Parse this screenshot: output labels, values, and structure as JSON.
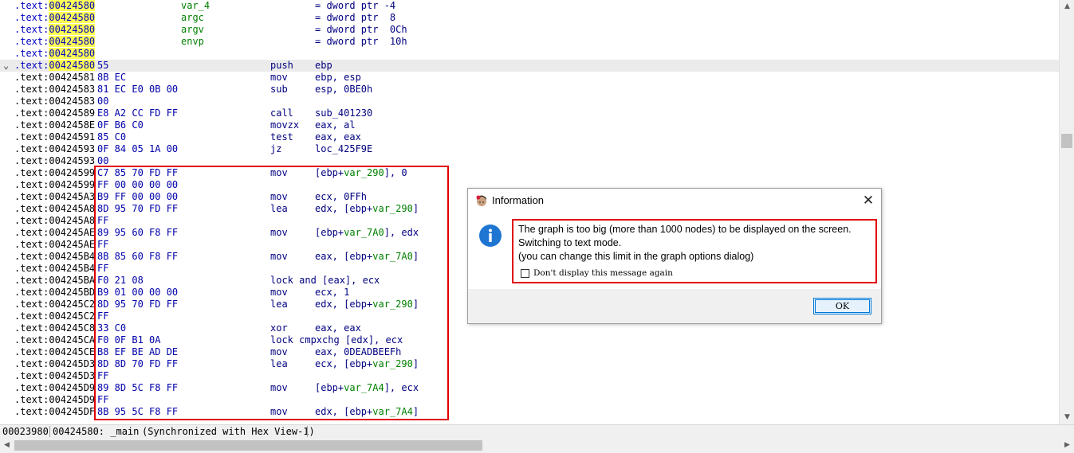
{
  "listing": {
    "rows": [
      {
        "seg": ".text:",
        "addr": "00424580",
        "hl": true,
        "bytes": "",
        "name": "var_4",
        "mnem": "",
        "ops": "= dword ptr -4"
      },
      {
        "seg": ".text:",
        "addr": "00424580",
        "hl": true,
        "bytes": "",
        "name": "argc",
        "mnem": "",
        "ops": "= dword ptr  8"
      },
      {
        "seg": ".text:",
        "addr": "00424580",
        "hl": true,
        "bytes": "",
        "name": "argv",
        "mnem": "",
        "ops": "= dword ptr  0Ch"
      },
      {
        "seg": ".text:",
        "addr": "00424580",
        "hl": true,
        "bytes": "",
        "name": "envp",
        "mnem": "",
        "ops": "= dword ptr  10h"
      },
      {
        "seg": ".text:",
        "addr": "00424580",
        "hl": true,
        "bytes": "",
        "name": "",
        "mnem": "",
        "ops": ""
      },
      {
        "seg": ".text:",
        "addr": "00424580",
        "hl": true,
        "bytes": "55",
        "name": "",
        "mnem": "push",
        "ops": "ebp",
        "current": true,
        "fold": "⌄"
      },
      {
        "seg": ".text:",
        "addr": "00424581",
        "bytes": "8B EC",
        "name": "",
        "mnem": "mov",
        "ops": "ebp, esp"
      },
      {
        "seg": ".text:",
        "addr": "00424583",
        "bytes": "81 EC E0 0B 00",
        "name": "",
        "mnem": "sub",
        "ops": "esp, 0BE0h"
      },
      {
        "seg": ".text:",
        "addr": "00424583",
        "bytes": "00",
        "name": "",
        "mnem": "",
        "ops": ""
      },
      {
        "seg": ".text:",
        "addr": "00424589",
        "bytes": "E8 A2 CC FD FF",
        "name": "",
        "mnem": "call",
        "ops": "sub_401230"
      },
      {
        "seg": ".text:",
        "addr": "0042458E",
        "bytes": "0F B6 C0",
        "name": "",
        "mnem": "movzx",
        "ops": "eax, al"
      },
      {
        "seg": ".text:",
        "addr": "00424591",
        "bytes": "85 C0",
        "name": "",
        "mnem": "test",
        "ops": "eax, eax"
      },
      {
        "seg": ".text:",
        "addr": "00424593",
        "bytes": "0F 84 05 1A 00",
        "name": "",
        "mnem": "jz",
        "ops": "loc_425F9E"
      },
      {
        "seg": ".text:",
        "addr": "00424593",
        "bytes": "00",
        "name": "",
        "mnem": "",
        "ops": ""
      },
      {
        "seg": ".text:",
        "addr": "00424599",
        "bytes": "C7 85 70 FD FF",
        "name": "",
        "mnem": "mov",
        "ops": "[ebp+",
        "ops_var": "var_290",
        "ops_tail": "], 0"
      },
      {
        "seg": ".text:",
        "addr": "00424599",
        "bytes": "FF 00 00 00 00",
        "name": "",
        "mnem": "",
        "ops": ""
      },
      {
        "seg": ".text:",
        "addr": "004245A3",
        "bytes": "B9 FF 00 00 00",
        "name": "",
        "mnem": "mov",
        "ops": "ecx, 0FFh"
      },
      {
        "seg": ".text:",
        "addr": "004245A8",
        "bytes": "8D 95 70 FD FF",
        "name": "",
        "mnem": "lea",
        "ops": "edx, [ebp+",
        "ops_var": "var_290",
        "ops_tail": "]"
      },
      {
        "seg": ".text:",
        "addr": "004245A8",
        "bytes": "FF",
        "name": "",
        "mnem": "",
        "ops": ""
      },
      {
        "seg": ".text:",
        "addr": "004245AE",
        "bytes": "89 95 60 F8 FF",
        "name": "",
        "mnem": "mov",
        "ops": "[ebp+",
        "ops_var": "var_7A0",
        "ops_tail": "], edx"
      },
      {
        "seg": ".text:",
        "addr": "004245AE",
        "bytes": "FF",
        "name": "",
        "mnem": "",
        "ops": ""
      },
      {
        "seg": ".text:",
        "addr": "004245B4",
        "bytes": "8B 85 60 F8 FF",
        "name": "",
        "mnem": "mov",
        "ops": "eax, [ebp+",
        "ops_var": "var_7A0",
        "ops_tail": "]"
      },
      {
        "seg": ".text:",
        "addr": "004245B4",
        "bytes": "FF",
        "name": "",
        "mnem": "",
        "ops": ""
      },
      {
        "seg": ".text:",
        "addr": "004245BA",
        "bytes": "F0 21 08",
        "name": "",
        "mnem": "lock and [eax], ecx",
        "ops": ""
      },
      {
        "seg": ".text:",
        "addr": "004245BD",
        "bytes": "B9 01 00 00 00",
        "name": "",
        "mnem": "mov",
        "ops": "ecx, 1"
      },
      {
        "seg": ".text:",
        "addr": "004245C2",
        "bytes": "8D 95 70 FD FF",
        "name": "",
        "mnem": "lea",
        "ops": "edx, [ebp+",
        "ops_var": "var_290",
        "ops_tail": "]"
      },
      {
        "seg": ".text:",
        "addr": "004245C2",
        "bytes": "FF",
        "name": "",
        "mnem": "",
        "ops": ""
      },
      {
        "seg": ".text:",
        "addr": "004245C8",
        "bytes": "33 C0",
        "name": "",
        "mnem": "xor",
        "ops": "eax, eax"
      },
      {
        "seg": ".text:",
        "addr": "004245CA",
        "bytes": "F0 0F B1 0A",
        "name": "",
        "mnem": "lock cmpxchg [edx], ecx",
        "ops": ""
      },
      {
        "seg": ".text:",
        "addr": "004245CE",
        "bytes": "B8 EF BE AD DE",
        "name": "",
        "mnem": "mov",
        "ops": "eax, 0DEADBEEFh"
      },
      {
        "seg": ".text:",
        "addr": "004245D3",
        "bytes": "8D 8D 70 FD FF",
        "name": "",
        "mnem": "lea",
        "ops": "ecx, [ebp+",
        "ops_var": "var_290",
        "ops_tail": "]"
      },
      {
        "seg": ".text:",
        "addr": "004245D3",
        "bytes": "FF",
        "name": "",
        "mnem": "",
        "ops": ""
      },
      {
        "seg": ".text:",
        "addr": "004245D9",
        "bytes": "89 8D 5C F8 FF",
        "name": "",
        "mnem": "mov",
        "ops": "[ebp+",
        "ops_var": "var_7A4",
        "ops_tail": "], ecx"
      },
      {
        "seg": ".text:",
        "addr": "004245D9",
        "bytes": "FF",
        "name": "",
        "mnem": "",
        "ops": ""
      },
      {
        "seg": ".text:",
        "addr": "004245DF",
        "bytes": "8B 95 5C F8 FF",
        "name": "",
        "mnem": "mov",
        "ops": "edx, [ebp+",
        "ops_var": "var_7A4",
        "ops_tail": "]"
      }
    ]
  },
  "status": {
    "offset": "00023980",
    "location": "00424580: _main",
    "sync": "(Synchronized with Hex View-1)"
  },
  "scrollbars": {
    "up": "▲",
    "down": "▼",
    "left": "◀",
    "right": "▶"
  },
  "dialog": {
    "title": "Information",
    "close": "✕",
    "icon": "info-icon",
    "lines": [
      "The graph is too big (more than 1000 nodes) to be displayed on the screen.",
      "Switching to text mode.",
      "(you can change this limit in the graph options dialog)"
    ],
    "checkbox_label": "Don't display this message again",
    "ok_label": "OK"
  },
  "colors": {
    "highlight": "#ffff55",
    "selection_box": "#e00000",
    "code_blue": "#000080",
    "name_green": "#008000",
    "info_blue": "#1f75d2"
  }
}
